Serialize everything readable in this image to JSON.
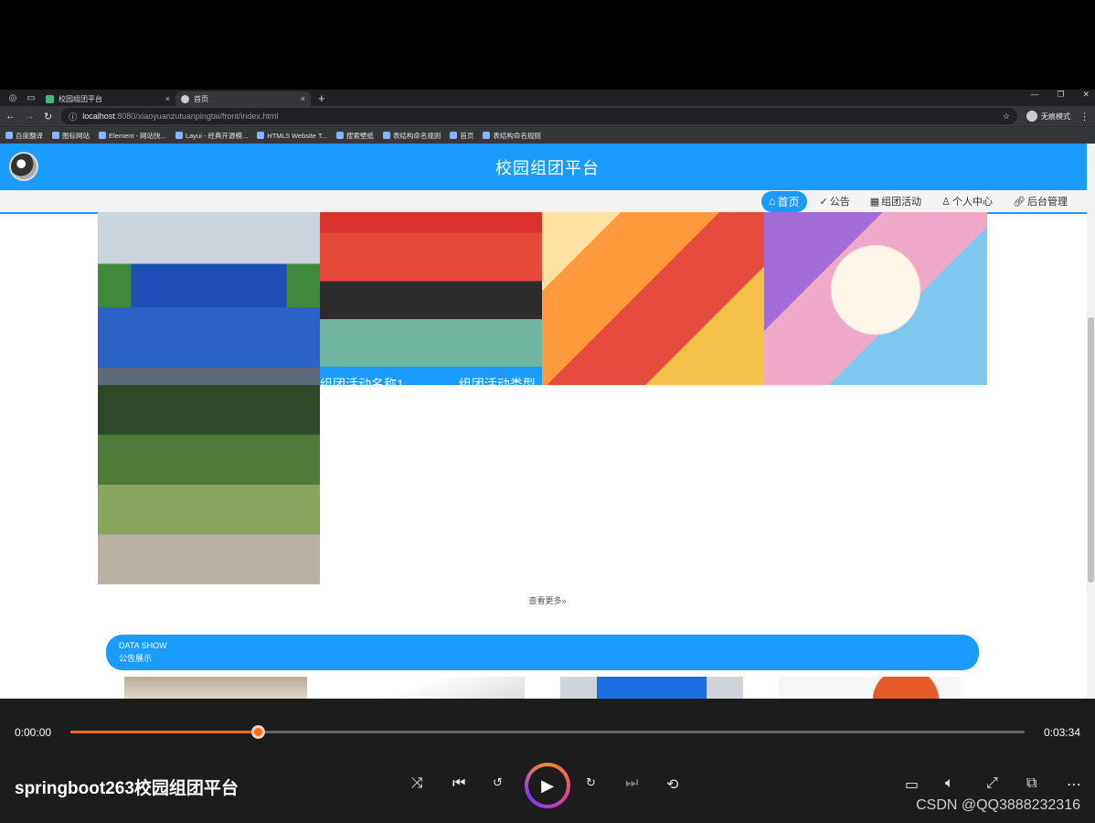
{
  "browser": {
    "tabs": [
      {
        "label": "校园组团平台",
        "active": false
      },
      {
        "label": "首页",
        "active": true
      }
    ],
    "url": {
      "host": "localhost",
      "rest": ":8080/xiaoyuanzutuanpingtai/front/index.html"
    },
    "incognito_label": "无痕模式",
    "bookmarks": [
      "百度翻译",
      "图标网站",
      "Element - 网站快...",
      "Layui - 经典开源模...",
      "HTML5 Website T...",
      "搜索壁纸",
      "表结构命名规则",
      "首页",
      "表结构命名规则"
    ]
  },
  "site": {
    "title": "校园组团平台",
    "nav": [
      {
        "label": "首页",
        "icon": "home-icon",
        "active": true
      },
      {
        "label": "公告",
        "icon": "check-circle-icon",
        "active": false
      },
      {
        "label": "组团活动",
        "icon": "grid-icon",
        "active": false
      },
      {
        "label": "个人中心",
        "icon": "user-icon",
        "active": false
      },
      {
        "label": "后台管理",
        "icon": "link-icon",
        "active": false
      }
    ],
    "card_overlay": {
      "name": "组团活动名称1",
      "type": "组团活动类型"
    },
    "more_link": "查看更多",
    "section": {
      "en": "DATA SHOW",
      "cn": "公告展示"
    }
  },
  "player": {
    "current_time": "0:00:00",
    "total_time": "0:03:34",
    "progress": 0.196,
    "video_title": "springboot263校园组团平台",
    "watermark": "CSDN @QQ3888232316"
  }
}
